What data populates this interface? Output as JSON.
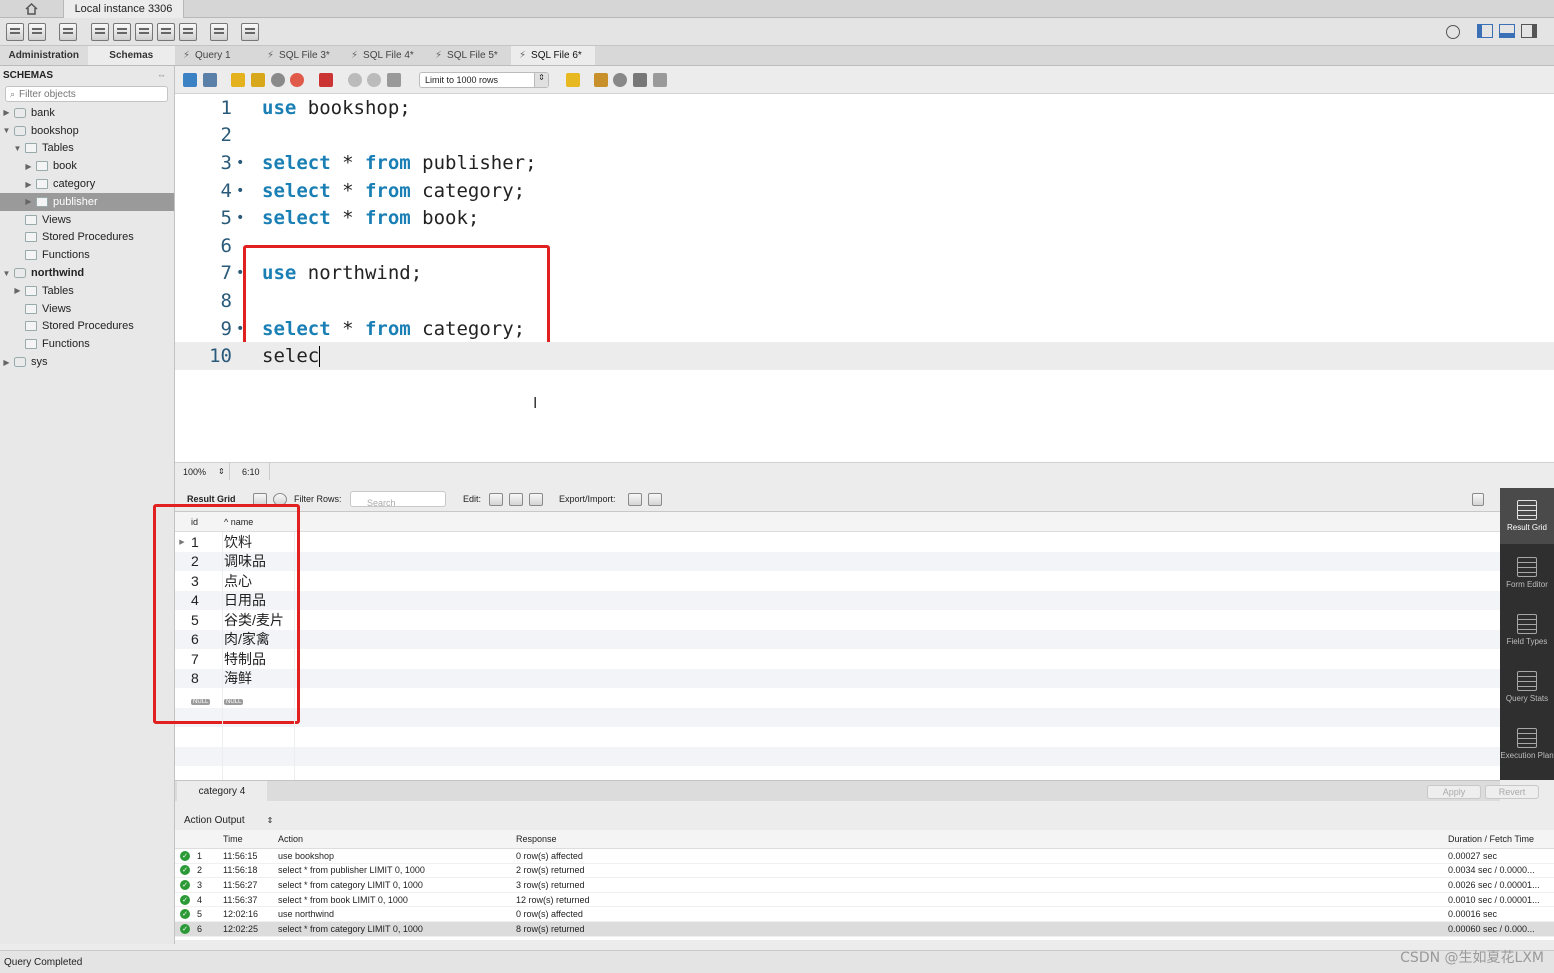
{
  "window": {
    "home_icon": "home-icon",
    "connection_tab": "Local instance 3306"
  },
  "sidebar": {
    "tabs": [
      "Administration",
      "Schemas"
    ],
    "header": "SCHEMAS",
    "filter_placeholder": "Filter objects",
    "tree": [
      {
        "label": "bank",
        "level": 0,
        "expander": "▶",
        "icon": "database-icon"
      },
      {
        "label": "bookshop",
        "level": 0,
        "expander": "▼",
        "icon": "database-icon"
      },
      {
        "label": "Tables",
        "level": 1,
        "expander": "▼",
        "icon": "folder-icon"
      },
      {
        "label": "book",
        "level": 2,
        "expander": "▶",
        "icon": "table-icon"
      },
      {
        "label": "category",
        "level": 2,
        "expander": "▶",
        "icon": "table-icon"
      },
      {
        "label": "publisher",
        "level": 2,
        "expander": "▶",
        "icon": "table-icon",
        "selected": true
      },
      {
        "label": "Views",
        "level": 1,
        "expander": "",
        "icon": "folder-icon"
      },
      {
        "label": "Stored Procedures",
        "level": 1,
        "expander": "",
        "icon": "folder-icon"
      },
      {
        "label": "Functions",
        "level": 1,
        "expander": "",
        "icon": "folder-icon"
      },
      {
        "label": "northwind",
        "level": 0,
        "expander": "▼",
        "icon": "database-icon",
        "bold": true
      },
      {
        "label": "Tables",
        "level": 1,
        "expander": "▶",
        "icon": "folder-icon"
      },
      {
        "label": "Views",
        "level": 1,
        "expander": "",
        "icon": "folder-icon"
      },
      {
        "label": "Stored Procedures",
        "level": 1,
        "expander": "",
        "icon": "folder-icon"
      },
      {
        "label": "Functions",
        "level": 1,
        "expander": "",
        "icon": "folder-icon"
      },
      {
        "label": "sys",
        "level": 0,
        "expander": "▶",
        "icon": "database-icon"
      }
    ]
  },
  "query_tabs": [
    {
      "label": "Query 1",
      "active": false
    },
    {
      "label": "SQL File 3*",
      "active": false
    },
    {
      "label": "SQL File 4*",
      "active": false
    },
    {
      "label": "SQL File 5*",
      "active": false
    },
    {
      "label": "SQL File 6*",
      "active": true
    }
  ],
  "editor_toolbar": {
    "limit_select": "Limit to 1000 rows"
  },
  "editor": {
    "lines": [
      {
        "n": "1",
        "dot": false,
        "kw": "use",
        "rest": " bookshop;"
      },
      {
        "n": "2",
        "dot": false,
        "kw": "",
        "rest": ""
      },
      {
        "n": "3",
        "dot": true,
        "kw": "select",
        "rest": " * ",
        "kw2": "from",
        "rest2": " publisher;"
      },
      {
        "n": "4",
        "dot": true,
        "kw": "select",
        "rest": " * ",
        "kw2": "from",
        "rest2": " category;"
      },
      {
        "n": "5",
        "dot": true,
        "kw": "select",
        "rest": " * ",
        "kw2": "from",
        "rest2": " book;"
      },
      {
        "n": "6",
        "dot": false,
        "kw": "",
        "rest": ""
      },
      {
        "n": "7",
        "dot": true,
        "kw": "use",
        "rest": " northwind;"
      },
      {
        "n": "8",
        "dot": false,
        "kw": "",
        "rest": ""
      },
      {
        "n": "9",
        "dot": true,
        "kw": "select",
        "rest": " * ",
        "kw2": "from",
        "rest2": " category;"
      },
      {
        "n": "10",
        "dot": false,
        "kw": "",
        "rest": "selec",
        "current": true
      }
    ],
    "zoom": "100%",
    "position": "6:10"
  },
  "result_toolbar": {
    "result_grid": "Result Grid",
    "filter_rows": "Filter Rows:",
    "search_placeholder": "Search",
    "edit": "Edit:",
    "export_import": "Export/Import:"
  },
  "result_grid": {
    "columns": [
      "id",
      "name"
    ],
    "rows": [
      [
        "1",
        "饮料"
      ],
      [
        "2",
        "调味品"
      ],
      [
        "3",
        "点心"
      ],
      [
        "4",
        "日用品"
      ],
      [
        "5",
        "谷类/麦片"
      ],
      [
        "6",
        "肉/家禽"
      ],
      [
        "7",
        "特制品"
      ],
      [
        "8",
        "海鲜"
      ]
    ],
    "null_label": "NULL"
  },
  "right_panel": [
    {
      "label": "Result Grid",
      "active": true
    },
    {
      "label": "Form Editor",
      "active": false
    },
    {
      "label": "Field Types",
      "active": false
    },
    {
      "label": "Query Stats",
      "active": false
    },
    {
      "label": "Execution Plan",
      "active": false
    }
  ],
  "result_tabs": {
    "tab": "category 4",
    "apply": "Apply",
    "revert": "Revert"
  },
  "output": {
    "selector": "Action Output",
    "columns": [
      "",
      "Time",
      "Action",
      "Response",
      "Duration / Fetch Time"
    ],
    "rows": [
      {
        "n": "1",
        "time": "11:56:15",
        "action": "use bookshop",
        "response": "0 row(s) affected",
        "duration": "0.00027 sec"
      },
      {
        "n": "2",
        "time": "11:56:18",
        "action": "select * from publisher LIMIT 0, 1000",
        "response": "2 row(s) returned",
        "duration": "0.0034 sec / 0.0000..."
      },
      {
        "n": "3",
        "time": "11:56:27",
        "action": "select * from category LIMIT 0, 1000",
        "response": "3 row(s) returned",
        "duration": "0.0026 sec / 0.00001..."
      },
      {
        "n": "4",
        "time": "11:56:37",
        "action": "select * from book LIMIT 0, 1000",
        "response": "12 row(s) returned",
        "duration": "0.0010 sec / 0.00001..."
      },
      {
        "n": "5",
        "time": "12:02:16",
        "action": "use northwind",
        "response": "0 row(s) affected",
        "duration": "0.00016 sec"
      },
      {
        "n": "6",
        "time": "12:02:25",
        "action": "select * from category LIMIT 0, 1000",
        "response": "8 row(s) returned",
        "duration": "0.00060 sec / 0.000..."
      }
    ]
  },
  "status": "Query Completed",
  "watermark": "CSDN @生如夏花LXM",
  "colors": {
    "keyword": "#1a7fb4",
    "highlight": "#e12020",
    "ok": "#2b9a36"
  }
}
